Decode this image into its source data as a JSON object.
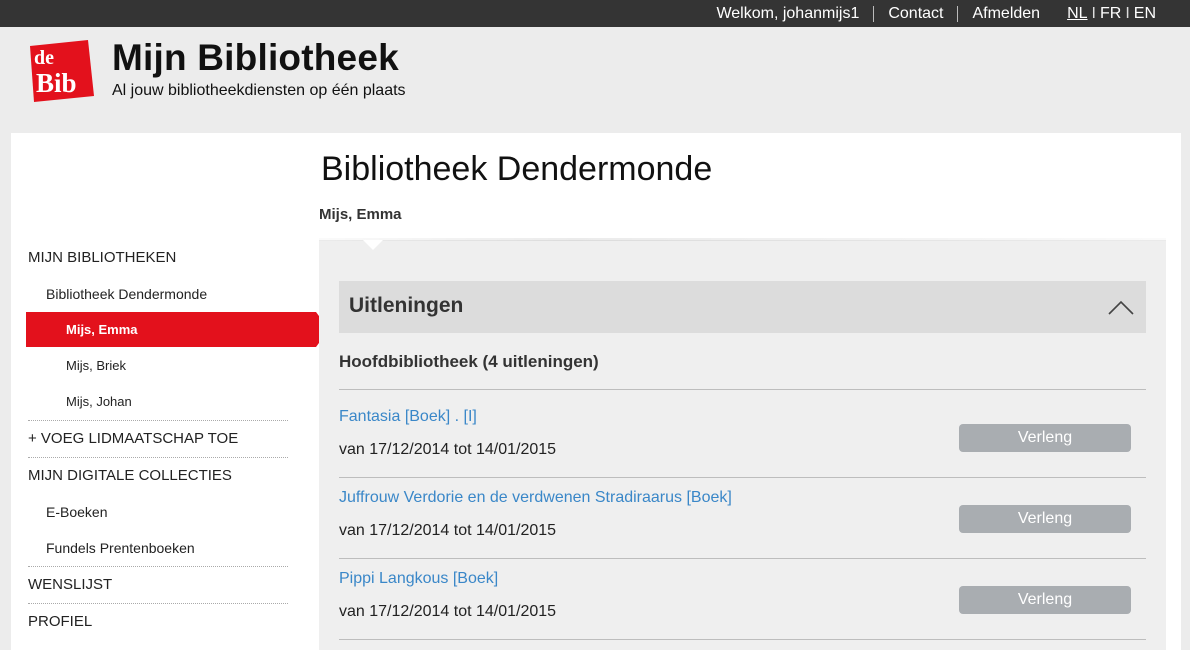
{
  "topbar": {
    "welcome": "Welkom, johanmijs1",
    "contact": "Contact",
    "logout": "Afmelden",
    "languages": [
      "NL",
      "FR",
      "EN"
    ],
    "active_language": "NL"
  },
  "header": {
    "logo_top": "de",
    "logo_bottom": "Bib",
    "title": "Mijn Bibliotheek",
    "subtitle": "Al jouw bibliotheekdiensten op één plaats"
  },
  "sidebar": {
    "my_libraries": "MIJN BIBLIOTHEKEN",
    "library": "Bibliotheek Dendermonde",
    "members": [
      "Mijs, Emma",
      "Mijs, Briek",
      "Mijs, Johan"
    ],
    "add_membership": "+ VOEG LIDMAATSCHAP TOE",
    "digital_collections": "MIJN DIGITALE COLLECTIES",
    "collections": [
      "E-Boeken",
      "Fundels Prentenboeken"
    ],
    "wishlist": "WENSLIJST",
    "profile": "PROFIEL"
  },
  "main": {
    "library_title": "Bibliotheek Dendermonde",
    "member_name": "Mijs, Emma",
    "section_title": "Uitleningen",
    "branch_title": "Hoofdbibliotheek (4 uitleningen)",
    "renew_label": "Verleng",
    "loans": [
      {
        "title": "Fantasia [Boek] . [I]",
        "period": "van 17/12/2014 tot 14/01/2015"
      },
      {
        "title": "Juffrouw Verdorie en de verdwenen Stradiraarus [Boek]",
        "period": "van 17/12/2014 tot 14/01/2015"
      },
      {
        "title": "Pippi Langkous [Boek]",
        "period": "van 17/12/2014 tot 14/01/2015"
      }
    ]
  },
  "colors": {
    "accent_red": "#e3111c",
    "link_blue": "#3a87c8",
    "topbar": "#343434",
    "button_grey": "#a9adb1"
  }
}
